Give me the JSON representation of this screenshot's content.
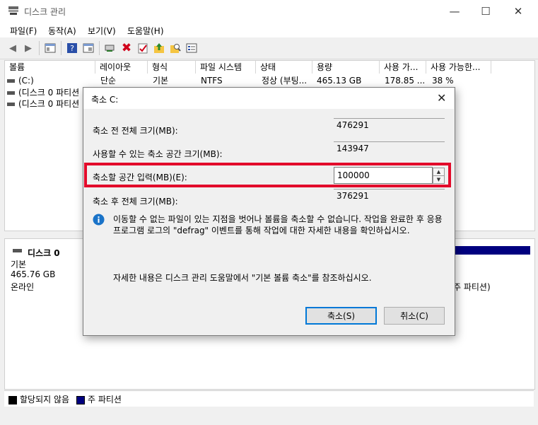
{
  "window": {
    "title": "디스크 관리",
    "minimize": "—",
    "maximize": "☐",
    "close": "✕"
  },
  "menu": [
    "파일(F)",
    "동작(A)",
    "보기(V)",
    "도움말(H)"
  ],
  "colors": {
    "highlight": "#e30b2b",
    "partition_primary": "#00007f",
    "info_icon": "#1a73c8"
  },
  "volume_list": {
    "columns": [
      "볼륨",
      "레이아웃",
      "형식",
      "파일 시스템",
      "상태",
      "용량",
      "사용 가...",
      "사용 가능한..."
    ],
    "rows": [
      {
        "name": "(C:)",
        "layout": "단순",
        "type": "기본",
        "fs": "NTFS",
        "status": "정상 (부팅...",
        "capacity": "465.13 GB",
        "free": "178.85 ...",
        "pct": "38 %"
      },
      {
        "name": "(디스크 0 파티션"
      },
      {
        "name": "(디스크 0 파티션"
      }
    ]
  },
  "disk": {
    "name": "디스크 0",
    "type": "기본",
    "size": "465.76 GB",
    "status": "온라인",
    "partition_label": "주 파티션)"
  },
  "legend": {
    "unallocated": "할당되지 않음",
    "primary": "주 파티션"
  },
  "dialog": {
    "title": "축소 C:",
    "total_before_label": "축소 전 전체 크기(MB):",
    "total_before_value": "476291",
    "available_label": "사용할 수 있는 축소 공간 크기(MB):",
    "available_value": "143947",
    "amount_label": "축소할 공간 입력(MB)(E):",
    "amount_value": "100000",
    "total_after_label": "축소 후 전체 크기(MB):",
    "total_after_value": "376291",
    "info_text": "이동할 수 없는 파일이 있는 지점을 벗어나 볼륨을 축소할 수 없습니다. 작업을 완료한 후 응용 프로그램 로그의 \"defrag\" 이벤트를 통해 작업에 대한 자세한 내용을 확인하십시오.",
    "help_text": "자세한 내용은 디스크 관리 도움말에서 \"기본 볼륨 축소\"를 참조하십시오.",
    "shrink_button": "축소(S)",
    "cancel_button": "취소(C)"
  }
}
